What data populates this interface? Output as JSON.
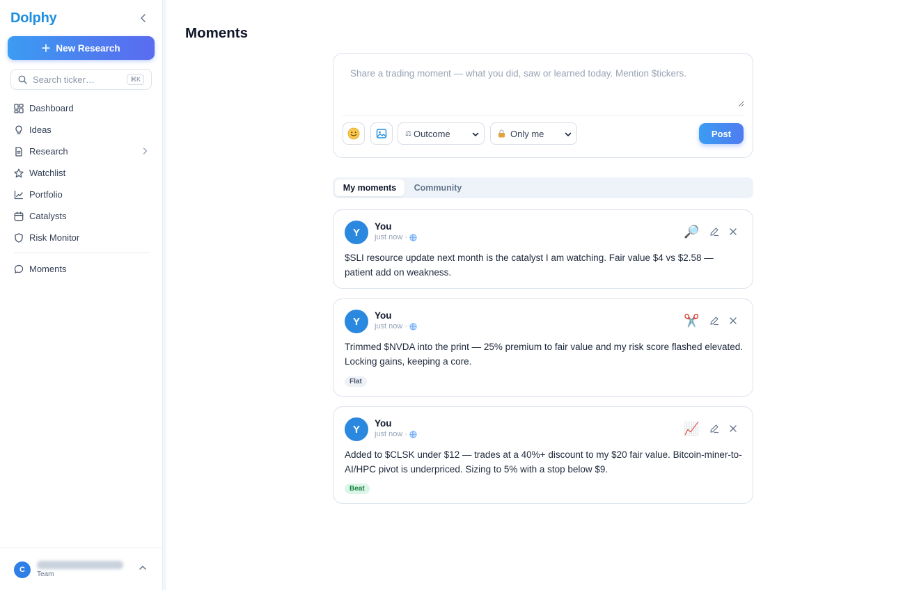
{
  "app": {
    "name": "Dolphy"
  },
  "sidebar": {
    "new_research_label": "New Research",
    "search": {
      "placeholder": "Search ticker…",
      "shortcut": "⌘K"
    },
    "items": [
      {
        "label": "Dashboard",
        "icon": "grid-icon"
      },
      {
        "label": "Ideas",
        "icon": "lightbulb-icon"
      },
      {
        "label": "Research",
        "icon": "document-icon"
      },
      {
        "label": "Watchlist",
        "icon": "star-icon"
      },
      {
        "label": "Portfolio",
        "icon": "chart-line-icon"
      },
      {
        "label": "Catalysts",
        "icon": "calendar-icon"
      },
      {
        "label": "Risk Monitor",
        "icon": "shield-icon"
      }
    ],
    "moments_label": "Moments",
    "user": {
      "initial": "C",
      "plan": "Team"
    }
  },
  "page": {
    "title": "Moments"
  },
  "composer": {
    "placeholder": "Share a trading moment — what you did, saw or learned today. Mention $tickers.",
    "outcome_select": "Outcome",
    "visibility_select": "Only me",
    "post_label": "Post"
  },
  "tabs": {
    "mine": "My moments",
    "community": "Community"
  },
  "moments": [
    {
      "initial": "Y",
      "author": "You",
      "time": "just now ·",
      "emoji": "🔎",
      "text": "$SLI resource update next month is the catalyst I am watching. Fair value $4 vs $2.58 — patient add on weakness.",
      "tag": ""
    },
    {
      "initial": "Y",
      "author": "You",
      "time": "just now ·",
      "emoji": "✂️",
      "text": "Trimmed $NVDA into the print — 25% premium to fair value and my risk score flashed elevated. Locking gains, keeping a core.",
      "tag": "Flat"
    },
    {
      "initial": "Y",
      "author": "You",
      "time": "just now ·",
      "emoji": "📈",
      "text": "Added to $CLSK under $12 — trades at a 40%+ discount to my $20 fair value. Bitcoin-miner-to-AI/HPC pivot is underpriced. Sizing to 5% with a stop below $9.",
      "tag": "Beat"
    }
  ],
  "colors": {
    "brand": "#1d8ee0",
    "accent": "#4f7cf0",
    "beat": "#15803d"
  }
}
